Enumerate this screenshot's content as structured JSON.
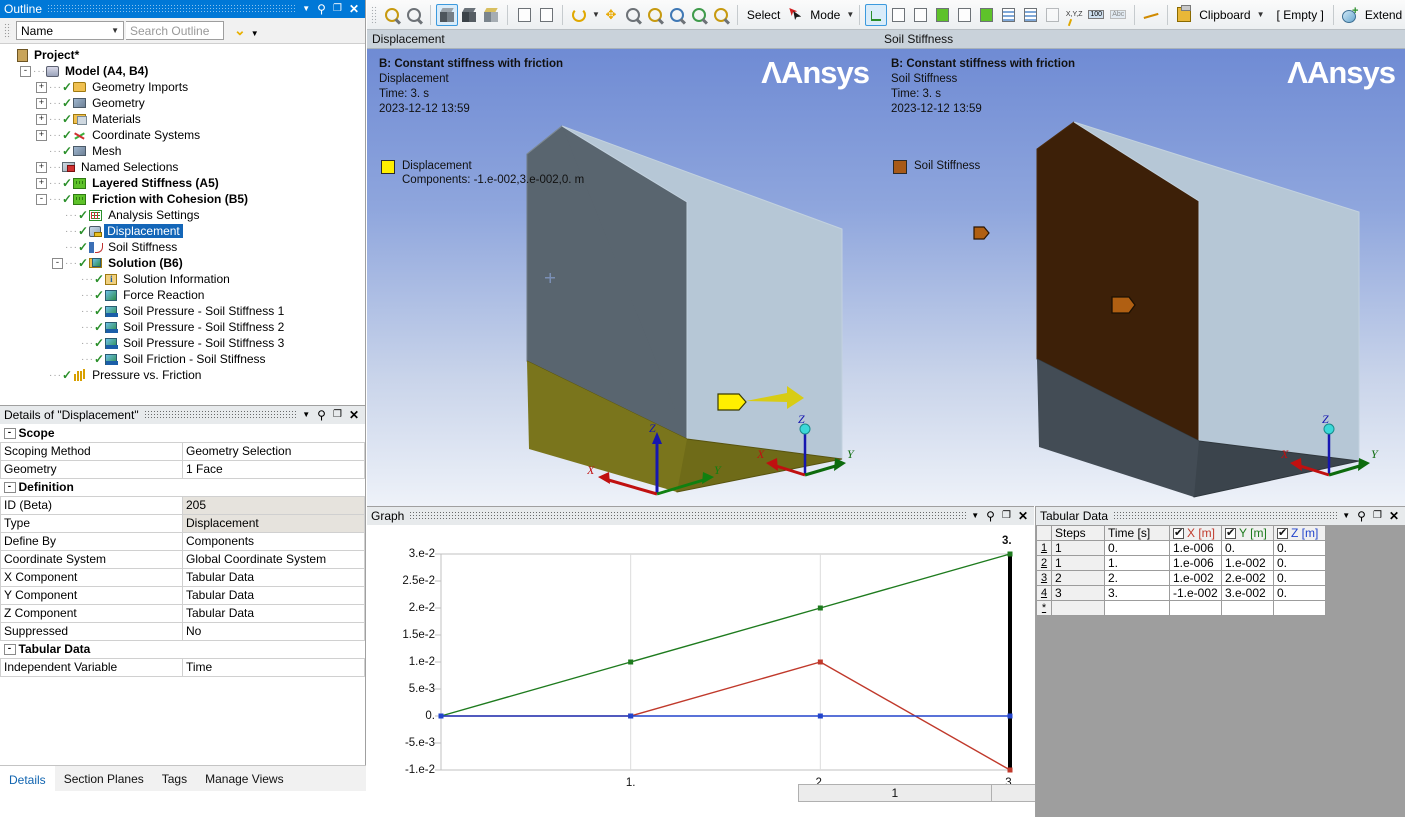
{
  "outline": {
    "title": "Outline",
    "filter_field": "Name",
    "search_placeholder": "Search Outline",
    "tree": [
      {
        "label": "Project*",
        "depth": 0,
        "bold": true,
        "expander": "",
        "check": false,
        "icon": "project-icon"
      },
      {
        "label": "Model (A4, B4)",
        "depth": 1,
        "bold": true,
        "expander": "-",
        "check": false,
        "icon": "model-icon"
      },
      {
        "label": "Geometry Imports",
        "depth": 2,
        "bold": false,
        "expander": "+",
        "check": true,
        "icon": "geometry-imports-icon"
      },
      {
        "label": "Geometry",
        "depth": 2,
        "bold": false,
        "expander": "+",
        "check": true,
        "icon": "geometry-icon"
      },
      {
        "label": "Materials",
        "depth": 2,
        "bold": false,
        "expander": "+",
        "check": true,
        "icon": "materials-icon"
      },
      {
        "label": "Coordinate Systems",
        "depth": 2,
        "bold": false,
        "expander": "+",
        "check": true,
        "icon": "coordinate-systems-icon"
      },
      {
        "label": "Mesh",
        "depth": 2,
        "bold": false,
        "expander": "",
        "check": true,
        "icon": "mesh-icon"
      },
      {
        "label": "Named Selections",
        "depth": 2,
        "bold": false,
        "expander": "+",
        "check": false,
        "icon": "named-selections-icon"
      },
      {
        "label": "Layered Stiffness (A5)",
        "depth": 2,
        "bold": true,
        "expander": "+",
        "check": true,
        "icon": "analysis-environment-icon"
      },
      {
        "label": "Friction with Cohesion (B5)",
        "depth": 2,
        "bold": true,
        "expander": "-",
        "check": true,
        "icon": "analysis-environment-icon"
      },
      {
        "label": "Analysis Settings",
        "depth": 3,
        "bold": false,
        "expander": "",
        "check": true,
        "icon": "analysis-settings-icon"
      },
      {
        "label": "Displacement",
        "depth": 3,
        "bold": false,
        "expander": "",
        "check": true,
        "icon": "displacement-icon",
        "selected": true
      },
      {
        "label": "Soil Stiffness",
        "depth": 3,
        "bold": false,
        "expander": "",
        "check": true,
        "icon": "soil-stiffness-icon"
      },
      {
        "label": "Solution (B6)",
        "depth": 3,
        "bold": true,
        "expander": "-",
        "check": true,
        "icon": "solution-icon"
      },
      {
        "label": "Solution Information",
        "depth": 4,
        "bold": false,
        "expander": "",
        "check": true,
        "icon": "solution-information-icon"
      },
      {
        "label": "Force Reaction",
        "depth": 4,
        "bold": false,
        "expander": "",
        "check": true,
        "icon": "result-icon"
      },
      {
        "label": "Soil Pressure - Soil Stiffness 1",
        "depth": 4,
        "bold": false,
        "expander": "",
        "check": true,
        "icon": "user-result-icon"
      },
      {
        "label": "Soil Pressure - Soil Stiffness 2",
        "depth": 4,
        "bold": false,
        "expander": "",
        "check": true,
        "icon": "user-result-icon"
      },
      {
        "label": "Soil Pressure - Soil Stiffness 3",
        "depth": 4,
        "bold": false,
        "expander": "",
        "check": true,
        "icon": "user-result-icon"
      },
      {
        "label": "Soil Friction - Soil Stiffness",
        "depth": 4,
        "bold": false,
        "expander": "",
        "check": true,
        "icon": "user-result-icon"
      },
      {
        "label": "Pressure vs. Friction",
        "depth": 2,
        "bold": false,
        "expander": "",
        "check": true,
        "icon": "chart-icon"
      }
    ]
  },
  "details": {
    "title": "Details of \"Displacement\"",
    "rows": [
      {
        "kind": "group",
        "label": "Scope"
      },
      {
        "kind": "row",
        "label": "Scoping Method",
        "value": "Geometry Selection",
        "gray": false
      },
      {
        "kind": "row",
        "label": "Geometry",
        "value": "1 Face",
        "gray": false
      },
      {
        "kind": "group",
        "label": "Definition"
      },
      {
        "kind": "row",
        "label": "ID (Beta)",
        "value": "205",
        "gray": true
      },
      {
        "kind": "row",
        "label": "Type",
        "value": "Displacement",
        "gray": true
      },
      {
        "kind": "row",
        "label": "Define By",
        "value": "Components",
        "gray": false
      },
      {
        "kind": "row",
        "label": "Coordinate System",
        "value": "Global Coordinate System",
        "gray": false
      },
      {
        "kind": "row",
        "label": "X Component",
        "value": "Tabular Data",
        "gray": false
      },
      {
        "kind": "row",
        "label": "Y Component",
        "value": "Tabular Data",
        "gray": false
      },
      {
        "kind": "row",
        "label": "Z Component",
        "value": "Tabular Data",
        "gray": false
      },
      {
        "kind": "row",
        "label": "Suppressed",
        "value": "No",
        "gray": false
      },
      {
        "kind": "group",
        "label": "Tabular Data"
      },
      {
        "kind": "row",
        "label": "Independent Variable",
        "value": "Time",
        "gray": false
      }
    ],
    "tabs": [
      {
        "label": "Details",
        "selected": true
      },
      {
        "label": "Section Planes",
        "selected": false
      },
      {
        "label": "Tags",
        "selected": false
      },
      {
        "label": "Manage Views",
        "selected": false
      }
    ]
  },
  "toolbar": {
    "select_label": "Select",
    "mode_label": "Mode",
    "clipboard_label": "Clipboard",
    "empty_label": "[ Empty ]",
    "extend_label": "Extend"
  },
  "viewport_left": {
    "tab_title": "Displacement",
    "brand": "Ansys",
    "analysis": "B: Constant stiffness with friction",
    "result": "Displacement",
    "time": "Time: 3. s",
    "timestamp": "2023-12-12 13:59",
    "legend_label": "Displacement",
    "legend_sub": "Components: -1.e-002,3.e-002,0. m",
    "legend_color": "#ffef00",
    "triad_labels": {
      "x": "X",
      "y": "Y",
      "z": "Z"
    }
  },
  "viewport_right": {
    "tab_title": "Soil Stiffness",
    "brand": "Ansys",
    "analysis": "B: Constant stiffness with friction",
    "result": "Soil Stiffness",
    "time": "Time: 3. s",
    "timestamp": "2023-12-12 13:59",
    "legend_label": "Soil Stiffness",
    "legend_color": "#a85a18",
    "triad_labels": {
      "x": "X",
      "y": "Y",
      "z": "Z"
    }
  },
  "graph": {
    "title": "Graph",
    "steps": [
      "1",
      "2",
      "3"
    ],
    "selected_step": "3"
  },
  "chart_data": {
    "type": "line",
    "title": "Graph",
    "xlabel": "",
    "ylabel": "",
    "x": [
      0,
      1,
      2,
      3
    ],
    "xlim": [
      0,
      3
    ],
    "ylim": [
      -0.01,
      0.03
    ],
    "xticks": [
      1,
      2,
      3
    ],
    "xticklabels": [
      "1.",
      "2.",
      "3."
    ],
    "yticks": [
      0.03,
      0.025,
      0.02,
      0.015,
      0.01,
      0.005,
      0,
      -0.005,
      -0.01
    ],
    "yticklabels": [
      "3.e-2",
      "2.5e-2",
      "2.e-2",
      "1.5e-2",
      "1.e-2",
      "5.e-3",
      "0.",
      "-5.e-3",
      "-1.e-2"
    ],
    "grid": true,
    "annotation_right": "3.",
    "series": [
      {
        "name": "X [m]",
        "color": "#c0392b",
        "values": [
          1e-06,
          1e-06,
          0.01,
          -0.01
        ]
      },
      {
        "name": "Y [m]",
        "color": "#1e7b1e",
        "values": [
          0.0,
          0.01,
          0.02,
          0.03
        ]
      },
      {
        "name": "Z [m]",
        "color": "#2244cc",
        "values": [
          0.0,
          0.0,
          0.0,
          0.0
        ]
      }
    ],
    "cursor_x": 3
  },
  "tabular": {
    "title": "Tabular Data",
    "columns": [
      "",
      "Steps",
      "Time [s]",
      "X [m]",
      "Y [m]",
      "Z [m]"
    ],
    "checkbox_columns": [
      "X [m]",
      "Y [m]",
      "Z [m]"
    ],
    "rows": [
      {
        "n": "1",
        "steps": "1",
        "time": "0.",
        "x": "1.e-006",
        "y": "0.",
        "z": "0."
      },
      {
        "n": "2",
        "steps": "1",
        "time": "1.",
        "x": "1.e-006",
        "y": "1.e-002",
        "z": "0."
      },
      {
        "n": "3",
        "steps": "2",
        "time": "2.",
        "x": "1.e-002",
        "y": "2.e-002",
        "z": "0."
      },
      {
        "n": "4",
        "steps": "3",
        "time": "3.",
        "x": "-1.e-002",
        "y": "3.e-002",
        "z": "0."
      },
      {
        "n": "*",
        "steps": "",
        "time": "",
        "x": "",
        "y": "",
        "z": ""
      }
    ]
  }
}
